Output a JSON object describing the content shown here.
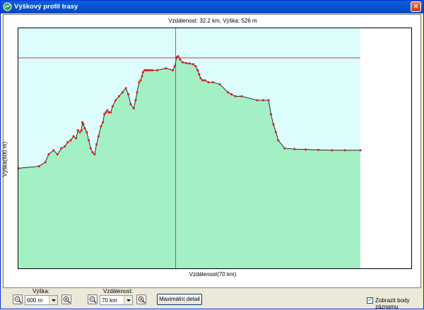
{
  "window": {
    "title": "Výškový profil trasy",
    "close_label": "×"
  },
  "chart_header": "Vzdálenost: 32.2 km, Výška: 526 m",
  "colors": {
    "fill": "#a3f0c4",
    "sky": "#ddfdfd",
    "line": "#000000",
    "point": "#dd2222",
    "crosshair": "#cc2222"
  },
  "chart_data": {
    "type": "area",
    "xlabel": "Vzdálenost(70 km)",
    "ylabel": "Výška(600 m)",
    "xlim": [
      0,
      70
    ],
    "ylim": [
      0,
      600
    ],
    "crosshair": {
      "x": 32.2,
      "y": 526
    },
    "x": [
      0,
      4.2,
      5.5,
      6.2,
      7.2,
      8.0,
      8.8,
      9.5,
      10.1,
      10.7,
      11.3,
      11.8,
      12.2,
      12.6,
      12.9,
      13.1,
      13.3,
      13.6,
      14.0,
      14.4,
      14.8,
      15.2,
      15.6,
      16.0,
      16.4,
      16.9,
      17.3,
      17.6,
      17.9,
      18.2,
      18.5,
      18.9,
      19.3,
      19.9,
      20.6,
      21.3,
      22.0,
      22.5,
      23.0,
      23.6,
      24.0,
      24.3,
      24.7,
      25.0,
      25.3,
      25.5,
      25.8,
      26.2,
      26.6,
      27.0,
      27.4,
      28.4,
      30.2,
      31.6,
      32.0,
      32.4,
      32.7,
      33.1,
      33.6,
      34.3,
      35.0,
      35.8,
      36.3,
      36.7,
      37.0,
      37.3,
      37.7,
      38.2,
      38.9,
      39.8,
      41.2,
      42.9,
      43.6,
      44.4,
      45.7,
      48.9,
      50.1,
      51.2,
      51.7,
      52.2,
      52.7,
      53.2,
      54.5,
      56.5,
      58.8,
      61.4,
      64.2,
      66.8,
      70.0
    ],
    "y": [
      250,
      255,
      265,
      285,
      295,
      285,
      300,
      305,
      315,
      320,
      330,
      325,
      345,
      340,
      345,
      365,
      360,
      350,
      340,
      320,
      300,
      290,
      285,
      310,
      330,
      355,
      365,
      385,
      390,
      395,
      390,
      390,
      405,
      420,
      430,
      440,
      450,
      435,
      410,
      400,
      420,
      440,
      465,
      470,
      480,
      490,
      495,
      495,
      495,
      495,
      495,
      495,
      500,
      495,
      505,
      528,
      530,
      522,
      515,
      513,
      512,
      510,
      505,
      495,
      485,
      475,
      470,
      470,
      465,
      465,
      460,
      440,
      435,
      430,
      430,
      420,
      420,
      420,
      385,
      360,
      340,
      320,
      300,
      298,
      297,
      296,
      295,
      295,
      295
    ]
  },
  "toolbar": {
    "height_label": "Výška:",
    "height_value": "600 m",
    "distance_label": "Vzdálenost:",
    "distance_value": "70 km",
    "max_detail": "Maximální detail",
    "show_points": "Zobrazit body záznamu",
    "zoom_out_icon": "zoom-out-icon",
    "zoom_in_icon": "zoom-in-icon"
  }
}
